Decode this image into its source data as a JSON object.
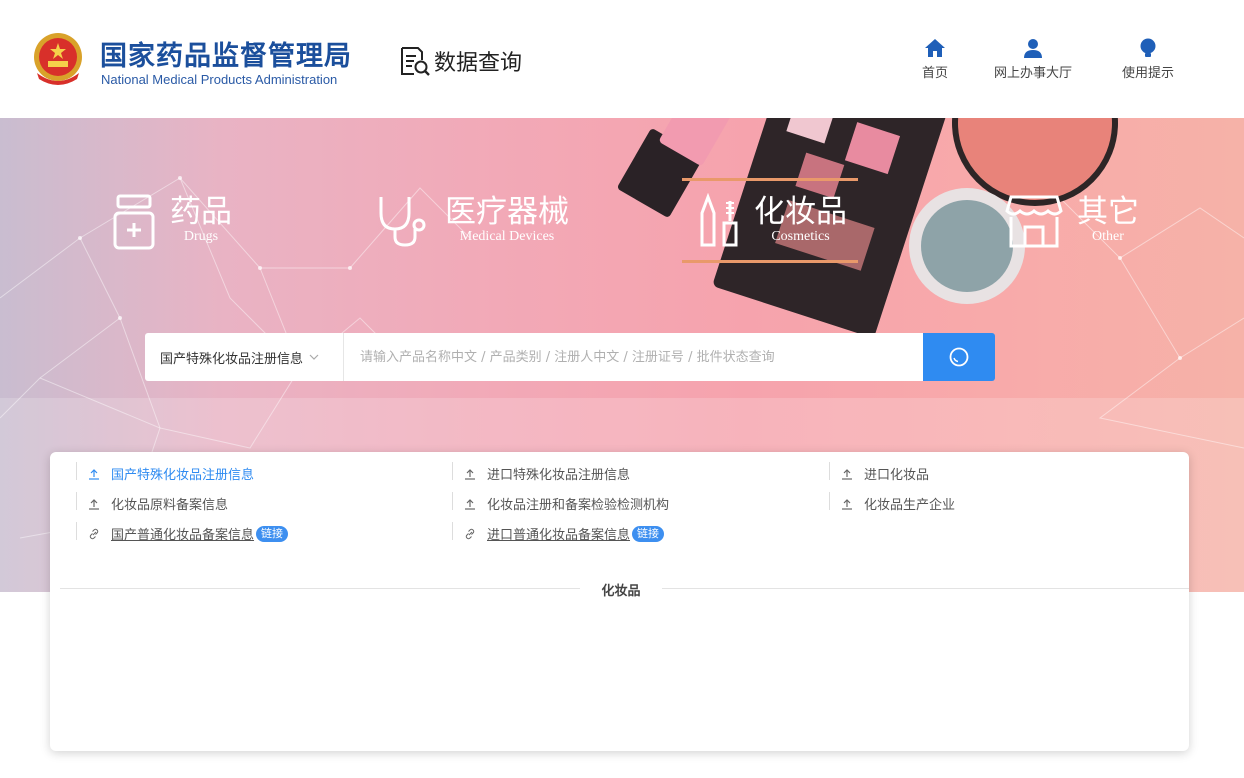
{
  "header": {
    "org_cn": "国家药品监督管理局",
    "org_en": "National Medical Products Administration",
    "section_title": "数据查询",
    "nav": [
      {
        "label": "首页",
        "icon": "home-icon"
      },
      {
        "label": "网上办事大厅",
        "icon": "user-icon"
      },
      {
        "label": "使用提示",
        "icon": "lightbulb-icon"
      }
    ]
  },
  "categories": [
    {
      "cn": "药品",
      "en": "Drugs",
      "icon": "medicine-bottle-icon",
      "active": false
    },
    {
      "cn": "医疗器械",
      "en": "Medical Devices",
      "icon": "stethoscope-icon",
      "active": false
    },
    {
      "cn": "化妆品",
      "en": "Cosmetics",
      "icon": "cosmetics-icon",
      "active": true
    },
    {
      "cn": "其它",
      "en": "Other",
      "icon": "shop-icon",
      "active": false
    }
  ],
  "search": {
    "selected": "国产特殊化妆品注册信息",
    "placeholder": "请输入产品名称中文 / 产品类别 / 注册人中文 / 注册证号 / 批件状态查询"
  },
  "links": [
    {
      "label": "国产特殊化妆品注册信息",
      "icon": "upload-icon",
      "active": true
    },
    {
      "label": "进口特殊化妆品注册信息",
      "icon": "upload-icon",
      "active": false
    },
    {
      "label": "进口化妆品",
      "icon": "upload-icon",
      "active": false
    },
    {
      "label": "化妆品原料备案信息",
      "icon": "upload-icon",
      "active": false
    },
    {
      "label": "化妆品注册和备案检验检测机构",
      "icon": "upload-icon",
      "active": false
    },
    {
      "label": "化妆品生产企业",
      "icon": "upload-icon",
      "active": false
    },
    {
      "label": "国产普通化妆品备案信息",
      "icon": "link-icon",
      "badge": "链接"
    },
    {
      "label": "进口普通化妆品备案信息",
      "icon": "link-icon",
      "badge": "链接"
    }
  ],
  "section_label": "化妆品",
  "colors": {
    "brand": "#1b4f9c",
    "accent": "#2f8bf1",
    "active_bar": "#e9996a"
  }
}
